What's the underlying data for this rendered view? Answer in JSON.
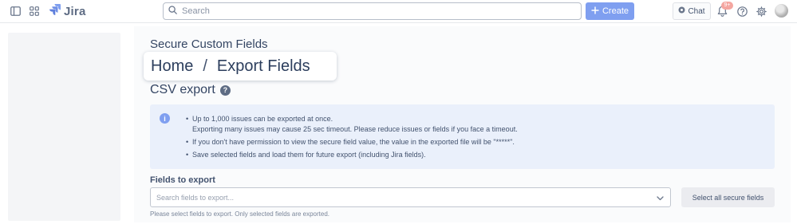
{
  "app": {
    "name": "Jira"
  },
  "header": {
    "search_placeholder": "Search",
    "create_label": "Create",
    "chat_label": "Chat",
    "notifications_badge": "9+",
    "icons": [
      "sidebar-toggle-icon",
      "app-switcher-icon",
      "jira-logo-icon",
      "search-icon",
      "plus-icon",
      "chat-icon",
      "bell-icon",
      "help-icon",
      "gear-icon",
      "avatar"
    ]
  },
  "page": {
    "title": "Secure Custom Fields",
    "breadcrumb": {
      "home": "Home",
      "separator": "/",
      "current": "Export Fields"
    },
    "section_title": "CSV export"
  },
  "info": {
    "items": [
      {
        "line1": "Up to 1,000 issues can be exported at once.",
        "line2": "Exporting many issues may cause 25 sec timeout. Please reduce issues or fields if you face a timeout."
      },
      {
        "line1": "If you don't have permission to view the secure field value, the value in the exported file will be \"*****\"."
      },
      {
        "line1": "Save selected fields and load them for future export (including Jira fields)."
      }
    ]
  },
  "fields": {
    "label": "Fields to export",
    "placeholder": "Search fields to export...",
    "select_all_label": "Select all secure fields",
    "hint": "Please select fields to export. Only selected fields are exported."
  },
  "colors": {
    "accent": "#7f9ff0",
    "info_bg": "#eaf0fb",
    "badge": "#f4a6a0"
  }
}
